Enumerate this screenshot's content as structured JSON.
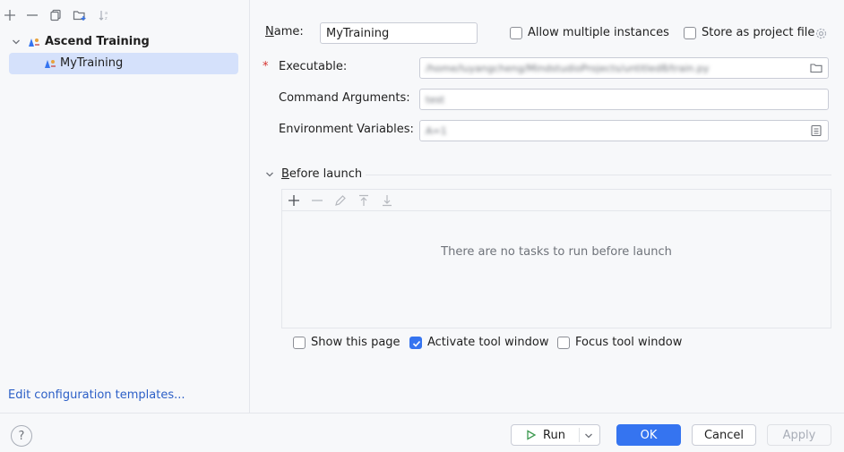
{
  "left_toolbar": {
    "icons": [
      "add-icon",
      "remove-icon",
      "copy-icon",
      "new-folder-icon",
      "sort-icon"
    ]
  },
  "tree": {
    "group_label": "Ascend Training",
    "item_label": "MyTraining"
  },
  "edit_templates_link": "Edit configuration templates...",
  "form": {
    "name_label_mnemonic": "N",
    "name_label_rest": "ame:",
    "name_value": "MyTraining",
    "allow_multiple_label": "Allow multiple instances",
    "store_project_label": "Store as project file",
    "required_marker": "*",
    "executable_label": "Executable:",
    "executable_value": "/home/luyangcheng/MindstudioProjects/untitled8/train.py",
    "command_args_label": "Command Arguments:",
    "command_args_value": "test",
    "env_vars_label": "Environment Variables:",
    "env_vars_value": "A=1"
  },
  "before_launch": {
    "title_mnemonic": "B",
    "title_rest": "efore launch",
    "empty_text": "There are no tasks to run before launch",
    "toolbar_icons": [
      "add-icon",
      "remove-icon",
      "edit-icon",
      "move-up-icon",
      "move-down-icon"
    ]
  },
  "options": {
    "show_page_label": "Show this page",
    "show_page_checked": false,
    "activate_tool_label": "Activate tool window",
    "activate_tool_checked": true,
    "focus_tool_label": "Focus tool window",
    "focus_tool_checked": false
  },
  "footer": {
    "help_label": "?",
    "run_label": "Run",
    "ok_label": "OK",
    "cancel_label": "Cancel",
    "apply_label": "Apply"
  },
  "colors": {
    "accent": "#3574f0",
    "selection": "#d5e1fb",
    "link": "#2c5fc7",
    "required": "#d5322e"
  }
}
